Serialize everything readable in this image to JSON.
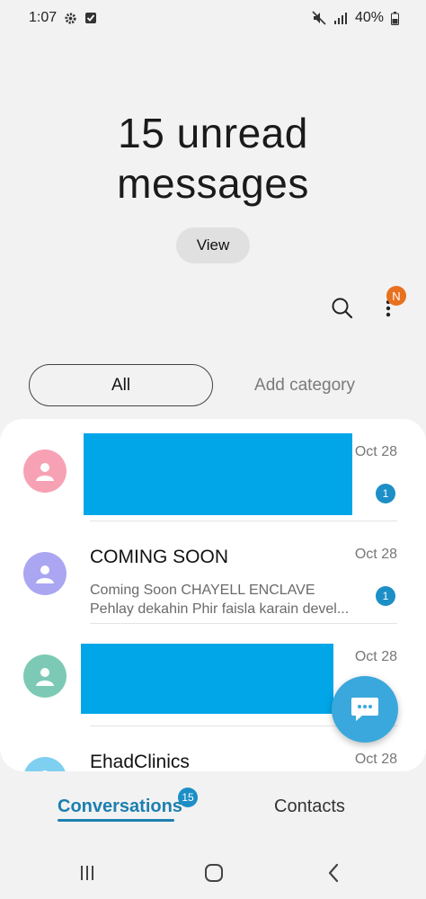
{
  "status_bar": {
    "time": "1:07",
    "battery": "40%",
    "icons": [
      "gear-icon",
      "check-square-icon",
      "mute-icon",
      "signal-icon",
      "battery-icon"
    ]
  },
  "header": {
    "unread_line1": "15 unread",
    "unread_line2": "messages",
    "view_label": "View"
  },
  "toolbar": {
    "notification_badge": "N",
    "icons": [
      "search-icon",
      "more-vertical-icon"
    ]
  },
  "categories": {
    "all_label": "All",
    "add_label": "Add category"
  },
  "conversations": [
    {
      "name": "",
      "preview1": "",
      "preview2": "",
      "date": "Oct 28",
      "unread": "1",
      "avatar_color": "#f7a2b4"
    },
    {
      "name": "COMING SOON",
      "preview1": "Coming Soon CHAYELL ENCLAVE",
      "preview2": "Pehlay dekahin Phir faisla karain devel...",
      "date": "Oct 28",
      "unread": "1",
      "avatar_color": "#aaa6f2"
    },
    {
      "name": "",
      "preview1": "",
      "preview2": "",
      "date": "Oct 28",
      "unread": "",
      "avatar_color": "#7ccab6"
    },
    {
      "name": "EhadClinics",
      "preview1": "",
      "preview2": "",
      "date": "Oct 28",
      "unread": "",
      "avatar_color": "#7fcff0"
    }
  ],
  "tabs": {
    "conversations_label": "Conversations",
    "conversations_badge": "15",
    "contacts_label": "Contacts"
  },
  "colors": {
    "accent": "#1c7fb0",
    "fab": "#3aa8dc",
    "badge_orange": "#e8711f",
    "redaction": "#00a6e8"
  }
}
